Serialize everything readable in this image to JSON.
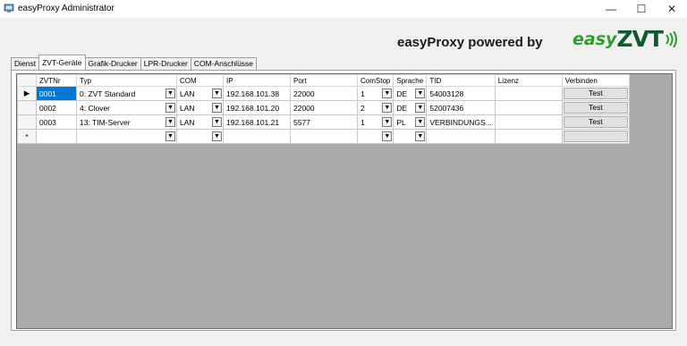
{
  "window": {
    "title": "easyProxy Administrator",
    "minimize": "—",
    "maximize": "☐",
    "close": "✕"
  },
  "brand": {
    "text": "easyProxy powered by",
    "logo_easy": "easy",
    "logo_zvt": "ZVT",
    "logo_color": "#2aa02a",
    "logo_dark": "#0d5b2a"
  },
  "tabs": [
    {
      "label": "Dienst"
    },
    {
      "label": "ZVT-Geräte",
      "active": true
    },
    {
      "label": "Grafik-Drucker"
    },
    {
      "label": "LPR-Drucker"
    },
    {
      "label": "COM-Anschlüsse"
    }
  ],
  "grid": {
    "columns": [
      "ZVTNr",
      "Typ",
      "COM",
      "IP",
      "Port",
      "ComStop",
      "Sprache",
      "TID",
      "Lizenz",
      "Verbinden"
    ],
    "rows": [
      {
        "marker": "▶",
        "zvtnr": "0001",
        "typ": "0: ZVT Standard",
        "com": "LAN",
        "ip": "192.168.101.38",
        "port": "22000",
        "comstop": "1",
        "sprache": "DE",
        "tid": "54003128",
        "lizenz": "",
        "verbinden": "Test"
      },
      {
        "marker": "",
        "zvtnr": "0002",
        "typ": "4: Clover",
        "com": "LAN",
        "ip": "192.168.101.20",
        "port": "22000",
        "comstop": "2",
        "sprache": "DE",
        "tid": "52007436",
        "lizenz": "",
        "verbinden": "Test"
      },
      {
        "marker": "",
        "zvtnr": "0003",
        "typ": "13: TIM-Server",
        "com": "LAN",
        "ip": "192.168.101.21",
        "port": "5577",
        "comstop": "1",
        "sprache": "PL",
        "tid": "VERBINDUNGS...",
        "lizenz": "",
        "verbinden": "Test"
      }
    ],
    "new_row_marker": "*",
    "selection_color": "#0078d7",
    "background_color": "#ababab"
  }
}
